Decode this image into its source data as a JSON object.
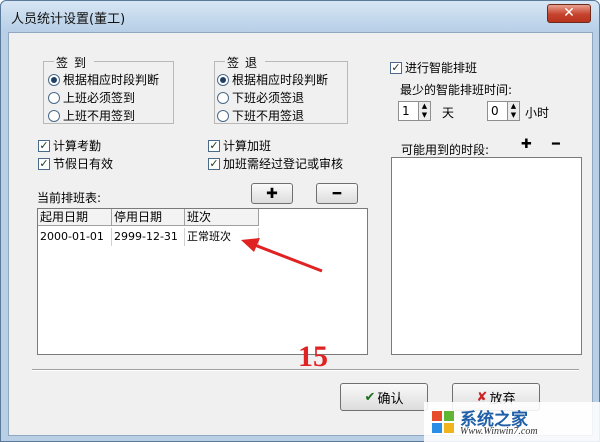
{
  "window": {
    "title": "人员统计设置(董工)",
    "close_glyph": "✕"
  },
  "sign_in": {
    "legend": "签到",
    "options": [
      "根据相应时段判断",
      "上班必须签到",
      "上班不用签到"
    ],
    "selected": 0
  },
  "sign_out": {
    "legend": "签退",
    "options": [
      "根据相应时段判断",
      "下班必须签退",
      "下班不用签退"
    ],
    "selected": 0
  },
  "checkboxes": {
    "attendance": "计算考勤",
    "holiday": "节假日有效",
    "overtime": "计算加班",
    "overtime_review": "加班需经过登记或审核"
  },
  "schedule": {
    "label": "当前排班表:",
    "add_glyph": "✚",
    "remove_glyph": "━",
    "columns": [
      "起用日期",
      "停用日期",
      "班次"
    ],
    "rows": [
      [
        "2000-01-01",
        "2999-12-31",
        "正常班次"
      ]
    ]
  },
  "smart": {
    "enabled_label": "进行智能排班",
    "min_time_label": "最少的智能排班时间:",
    "days_value": "1",
    "days_unit": "天",
    "hours_value": "0",
    "hours_unit": "小时",
    "periods_label": "可能用到的时段:",
    "add_glyph": "✚",
    "remove_glyph": "━"
  },
  "footer": {
    "confirm_label": "确认",
    "cancel_label": "放弃",
    "annotation_number": "15"
  },
  "watermark": {
    "text": "系统之家",
    "url_text": "Www.Winwin7.com"
  },
  "colors": {
    "annotation": "#e02222",
    "title_bar": "#b7cfe7",
    "close_button": "#c5432d"
  }
}
